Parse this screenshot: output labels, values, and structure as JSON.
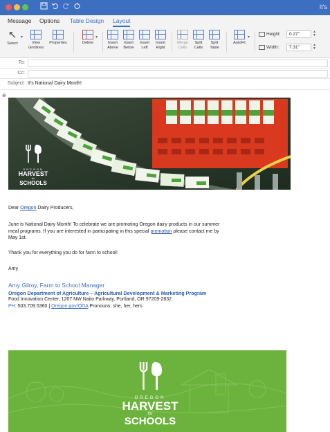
{
  "window": {
    "title_right": "It's",
    "qat_icons": [
      "save-icon",
      "undo-icon",
      "redo-icon",
      "refresh-icon"
    ]
  },
  "tabs": [
    {
      "label": "Message",
      "state": "normal"
    },
    {
      "label": "Options",
      "state": "normal"
    },
    {
      "label": "Table Design",
      "state": "contextual"
    },
    {
      "label": "Layout",
      "state": "active"
    }
  ],
  "ribbon": {
    "select": "Select",
    "view_gridlines": [
      "View",
      "Gridlines"
    ],
    "properties": "Properties",
    "delete": "Delete",
    "insert_above": [
      "Insert",
      "Above"
    ],
    "insert_below": [
      "Insert",
      "Below"
    ],
    "insert_left": [
      "Insert",
      "Left"
    ],
    "insert_right": [
      "Insert",
      "Right"
    ],
    "merge_cells": [
      "Merge",
      "Cells"
    ],
    "split_cells": [
      "Split",
      "Cells"
    ],
    "split_table": [
      "Split",
      "Table"
    ],
    "autofit": "AutoFit",
    "height_label": "Height:",
    "height_value": "0.27\"",
    "width_label": "Width:",
    "width_value": "7.31\""
  },
  "header": {
    "to_label": "To:",
    "to_value": "",
    "cc_label": "Cc:",
    "cc_value": "",
    "subject_label": "Subject:",
    "subject_value": "It's National Dairy Month!"
  },
  "hero": {
    "logo_lines": [
      "OREGON",
      "HARVEST",
      "for",
      "SCHOOLS"
    ]
  },
  "email": {
    "greeting_pre": "Dear ",
    "greeting_link": "Oregon",
    "greeting_post": " Dairy Producers,",
    "para1_line1": "June is National Dairy Month!  To celebrate we are promoting Oregon dairy products in our summer",
    "para1_line2_pre": "meal programs. If you are interested in participating in this special ",
    "para1_link": "promotion",
    "para1_line2_post": " please contact me by",
    "para1_line3": "May 1st.",
    "para2": "Thank you for everything you do for farm to school!",
    "signoff": "Amy"
  },
  "signature": {
    "name_title": "Amy Gilroy, Farm to School Manager",
    "department": "Oregon Department of Agriculture – Agricultural Development & Marketing Program",
    "address": "Food Innovation Center, 1207 NW Naito Parkway, Portland, OR 97209-2832",
    "phone_label": "PH:",
    "phone": "503.709.5360",
    "sep": " | ",
    "website": "Oregon.gov/ODA",
    "pronouns": " Pronouns: she, her, hers"
  },
  "banner": {
    "logo_lines": [
      "OREGON",
      "HARVEST",
      "for",
      "SCHOOLS"
    ]
  },
  "colors": {
    "titlebar": "#3d6fc1",
    "accent_blue": "#3f6fc2",
    "banner_green": "#6cb33e",
    "crate_red": "#d8391f"
  }
}
